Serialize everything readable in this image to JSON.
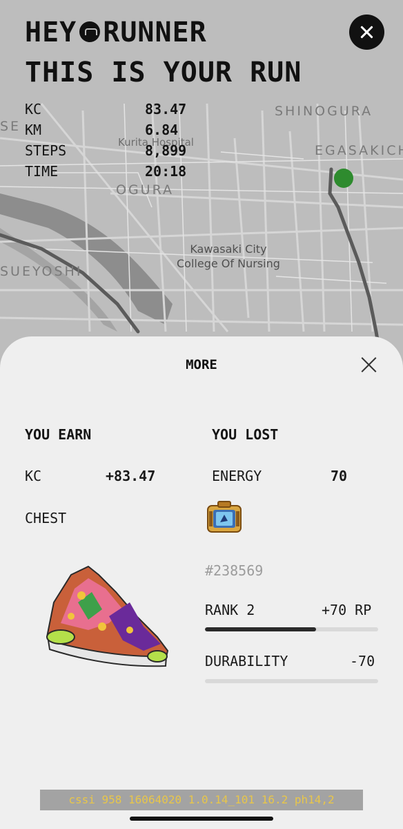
{
  "header": {
    "line1_left": "HEY",
    "line1_right": "RUNNER",
    "line2": "THIS IS YOUR RUN"
  },
  "stats": [
    {
      "label": "KC",
      "value": "83.47"
    },
    {
      "label": "KM",
      "value": "6.84"
    },
    {
      "label": "STEPS",
      "value": "8,899"
    },
    {
      "label": "TIME",
      "value": "20:18"
    }
  ],
  "map": {
    "labels": {
      "shinogura": "SHINOGURA",
      "egasakichi": "EGASAKICH",
      "kurita": "Kurita Hospital",
      "ogura": "OGURA",
      "kawasaki": "Kawasaki City\nCollege Of Nursing",
      "suyoshi": "SUEYOSHI",
      "se": "SE"
    },
    "marker_color": "#2e8b2e"
  },
  "sheet": {
    "title": "MORE",
    "earn": {
      "heading": "YOU EARN",
      "kc_label": "KC",
      "kc_value": "+83.47",
      "chest_label": "CHEST"
    },
    "lost": {
      "heading": "YOU LOST",
      "energy_label": "ENERGY",
      "energy_value": "70"
    },
    "sneaker_id": "#238569",
    "rank": {
      "label": "RANK 2",
      "value": "+70 RP",
      "progress": 0.64
    },
    "durability": {
      "label": "DURABILITY",
      "value": "-70",
      "progress": 0.0
    }
  },
  "footer": {
    "build_info": "cssi 958 16064020 1.0.14_101 16.2 ph14,2"
  }
}
